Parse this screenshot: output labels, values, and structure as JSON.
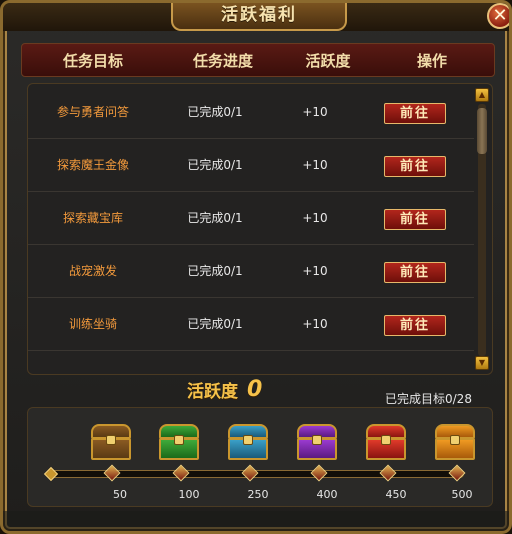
{
  "window": {
    "title": "活跃福利",
    "close_label": "✕"
  },
  "table": {
    "headers": [
      "任务目标",
      "任务进度",
      "活跃度",
      "操作"
    ],
    "rows": [
      {
        "name": "参与勇者问答",
        "progress": "已完成0/1",
        "points": "+10",
        "action": "前往"
      },
      {
        "name": "探索魔王金像",
        "progress": "已完成0/1",
        "points": "+10",
        "action": "前往"
      },
      {
        "name": "探索藏宝库",
        "progress": "已完成0/1",
        "points": "+10",
        "action": "前往"
      },
      {
        "name": "战宠激发",
        "progress": "已完成0/1",
        "points": "+10",
        "action": "前往"
      },
      {
        "name": "训练坐骑",
        "progress": "已完成0/1",
        "points": "+10",
        "action": "前往"
      }
    ]
  },
  "scrollbar": {
    "up_icon": "triangle-up",
    "down_icon": "triangle-down"
  },
  "activity": {
    "label": "活跃度",
    "value": "0",
    "completed_text": "已完成目标0/28"
  },
  "rewards": {
    "progress_fraction": 0,
    "milestones": [
      {
        "value": "50",
        "chest": "gold"
      },
      {
        "value": "100",
        "chest": "green"
      },
      {
        "value": "250",
        "chest": "blue"
      },
      {
        "value": "400",
        "chest": "purple"
      },
      {
        "value": "450",
        "chest": "red"
      },
      {
        "value": "500",
        "chest": "orange"
      }
    ]
  },
  "colors": {
    "accent_gold": "#f6c24a",
    "task_name": "#f39a3c",
    "button_red": "#b2261c"
  }
}
